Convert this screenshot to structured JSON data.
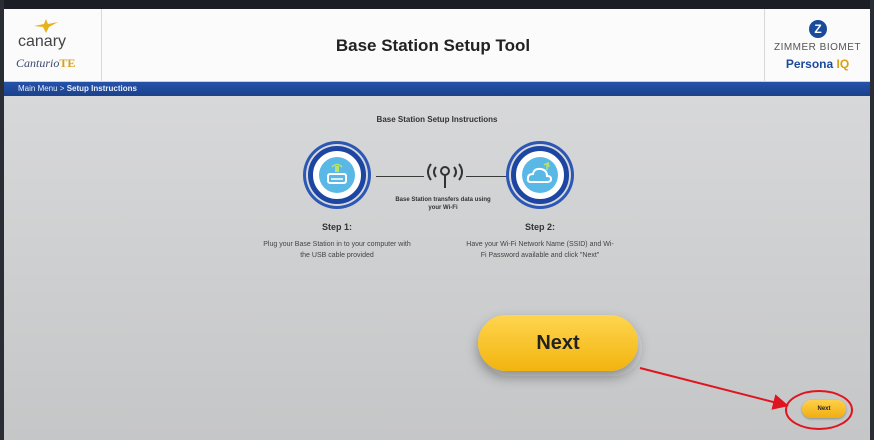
{
  "header": {
    "title": "Base Station Setup Tool",
    "left_logo": {
      "brand": "canary",
      "sub_prefix": "Canturio",
      "sub_suffix": "TE",
      "icon": "bird-logo-icon"
    },
    "right_logo": {
      "mark": "Z",
      "company": "ZIMMER BIOMET",
      "product_prefix": "Persona ",
      "product_suffix": "IQ"
    }
  },
  "breadcrumb": {
    "root": "Main Menu",
    "separator": " > ",
    "current": "Setup Instructions"
  },
  "content": {
    "subtitle": "Base Station Setup Instructions",
    "transfer_text": "Base Station transfers data using your Wi-Fi",
    "steps": [
      {
        "title": "Step 1:",
        "description": "Plug your Base Station in to your computer with the USB cable provided",
        "icon": "base-station-icon"
      },
      {
        "title": "Step 2:",
        "description": "Have your Wi-Fi Network Name (SSID) and Wi-Fi Password available and click \"Next\"",
        "icon": "cloud-wifi-icon"
      }
    ],
    "next_callout_label": "Next",
    "next_button_label": "Next"
  },
  "colors": {
    "brand_blue": "#1d46a3",
    "accent_yellow": "#f2b40e",
    "annotation_red": "#e0141e"
  }
}
